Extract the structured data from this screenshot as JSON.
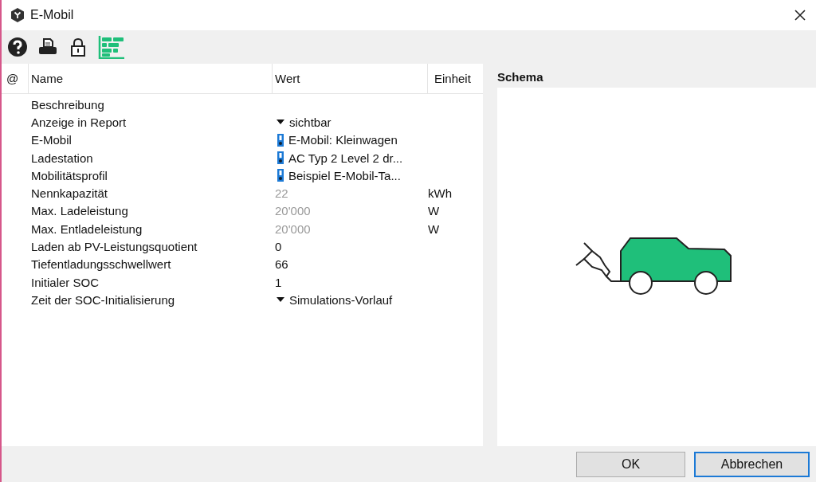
{
  "window": {
    "title": "E-Mobil"
  },
  "table": {
    "columns": [
      "@",
      "Name",
      "Wert",
      "Einheit"
    ],
    "rows": [
      {
        "name": "Beschreibung"
      },
      {
        "name": "Anzeige in Report",
        "kind": "dropdown",
        "value": "sichtbar"
      },
      {
        "name": "E-Mobil",
        "kind": "link",
        "value": "E-Mobil: Kleinwagen"
      },
      {
        "name": "Ladestation",
        "kind": "link",
        "value": "AC Typ 2 Level 2 dr..."
      },
      {
        "name": "Mobilitätsprofil",
        "kind": "link",
        "value": "Beispiel E-Mobil-Ta..."
      },
      {
        "name": "Nennkapazität",
        "kind": "number",
        "value": "22",
        "unit": "kWh",
        "disabled": true
      },
      {
        "name": "Max. Ladeleistung",
        "kind": "number",
        "value": "20'000",
        "unit": "W",
        "disabled": true
      },
      {
        "name": "Max. Entladeleistung",
        "kind": "number",
        "value": "20'000",
        "unit": "W",
        "disabled": true
      },
      {
        "name": "Laden ab PV-Leistungsquotient",
        "kind": "number",
        "value": "0",
        "disabled": false
      },
      {
        "name": "Tiefentladungsschwellwert",
        "kind": "number",
        "value": "66",
        "disabled": false
      },
      {
        "name": "Initialer SOC",
        "kind": "number",
        "value": "1",
        "disabled": false
      },
      {
        "name": "Zeit der SOC-Initialisierung",
        "kind": "dropdown",
        "value": "Simulations-Vorlauf"
      }
    ]
  },
  "schema": {
    "title": "Schema"
  },
  "buttons": [
    {
      "label": "OK",
      "selected": false
    },
    {
      "label": "Abbrechen",
      "selected": true
    }
  ]
}
